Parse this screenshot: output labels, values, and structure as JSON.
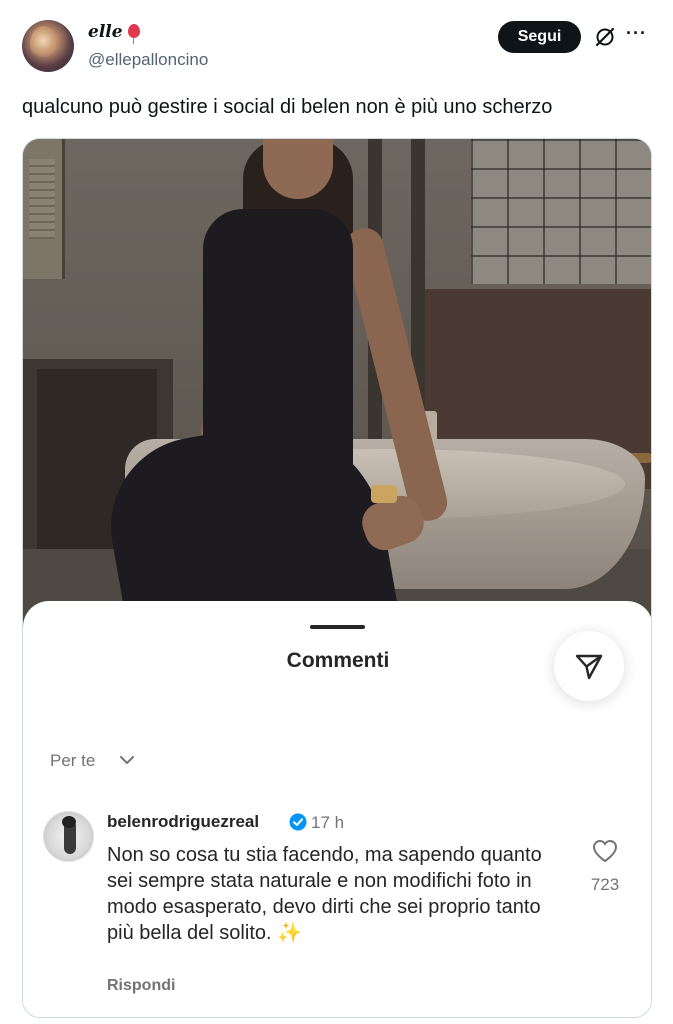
{
  "tweet": {
    "display_name": "elle",
    "handle": "@ellepalloncino",
    "follow_label": "Segui",
    "more_label": "···",
    "text": "qualcuno può gestire i social di belen non è più uno scherzo"
  },
  "comments_sheet": {
    "title": "Commenti",
    "filter_label": "Per te",
    "comment": {
      "username": "belenrodriguezreal",
      "time": "17 h",
      "text": "Non so cosa tu stia facendo, ma sapendo quanto sei sempre stata naturale e non modifichi foto in modo esasperato, devo dirti che sei proprio tanto più bella del solito.",
      "emoji": "✨",
      "reply_label": "Rispondi",
      "likes": "723"
    }
  },
  "colors": {
    "text_primary": "#0f1419",
    "text_secondary": "#536471",
    "ig_text": "#262626",
    "ig_muted": "#737373",
    "verified_blue": "#0095f6",
    "follow_bg": "#0f1419"
  },
  "icons": {
    "grok": "slashed-circle-icon",
    "more": "more-icon",
    "share": "send-icon",
    "chevron": "chevron-down-icon",
    "verified": "verified-badge-icon",
    "like": "heart-icon",
    "balloon": "balloon-emoji"
  }
}
